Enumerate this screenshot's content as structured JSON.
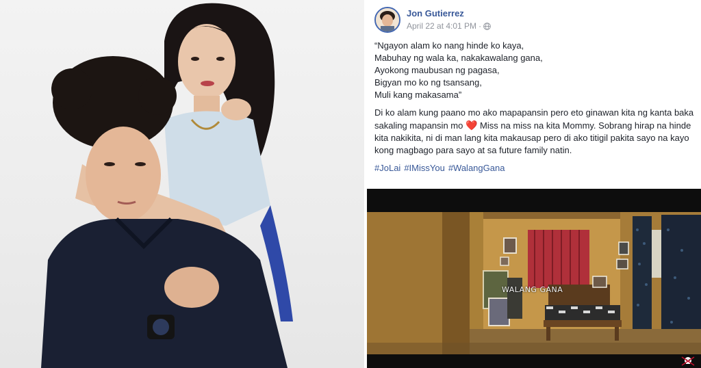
{
  "post": {
    "author": "Jon Gutierrez",
    "timestamp": "April 22 at 4:01 PM",
    "separator": "·",
    "privacy_icon": "globe-icon",
    "lyrics": "“Ngayon alam ko nang hinde ko kaya,\nMabuhay ng wala ka, nakakawalang gana,\nAyokong maubusan ng pagasa,\nBigyan mo ko ng tsansang,\nMuli kang makasama”",
    "message_before_heart": "Di ko alam kung paano mo ako mapapansin pero eto ginawan kita ng kanta baka sakaling mapansin mo",
    "heart_emoji": "❤️",
    "message_after_heart": " Miss na miss na kita Mommy. Sobrang hirap na hinde kita nakikita, ni di man lang kita makausap pero di ako titigil pakita sayo na kayo kong magbago para sayo at sa future family natin.",
    "hashtags": [
      "#JoLai",
      "#IMissYou",
      "#WalangGana"
    ]
  },
  "video": {
    "overlay_title": "WALANG GANA"
  },
  "colors": {
    "link": "#385898",
    "text": "#1d2129",
    "meta": "#90949c",
    "curtain": "#b0303a"
  }
}
